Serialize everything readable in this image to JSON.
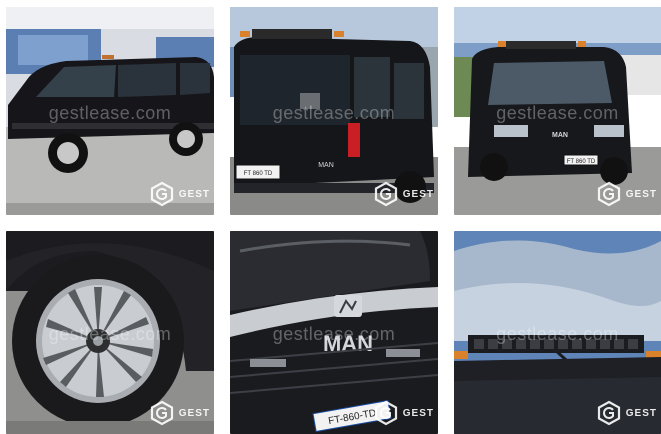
{
  "gallery": {
    "watermark_text": "gestlease.com",
    "brand_text": "GEST",
    "brand_icon": "gestlease-logo-icon",
    "photos": [
      {
        "label": "photo-van-side"
      },
      {
        "label": "photo-van-rear",
        "plate": "FT 860 TD",
        "emblem": "MAN"
      },
      {
        "label": "photo-van-front",
        "plate": "FT 860 TD",
        "emblem": "MAN"
      },
      {
        "label": "photo-wheel"
      },
      {
        "label": "photo-grille",
        "emblem": "MAN",
        "plate": "FT-860-TD"
      },
      {
        "label": "photo-roof-lightbar"
      }
    ]
  }
}
